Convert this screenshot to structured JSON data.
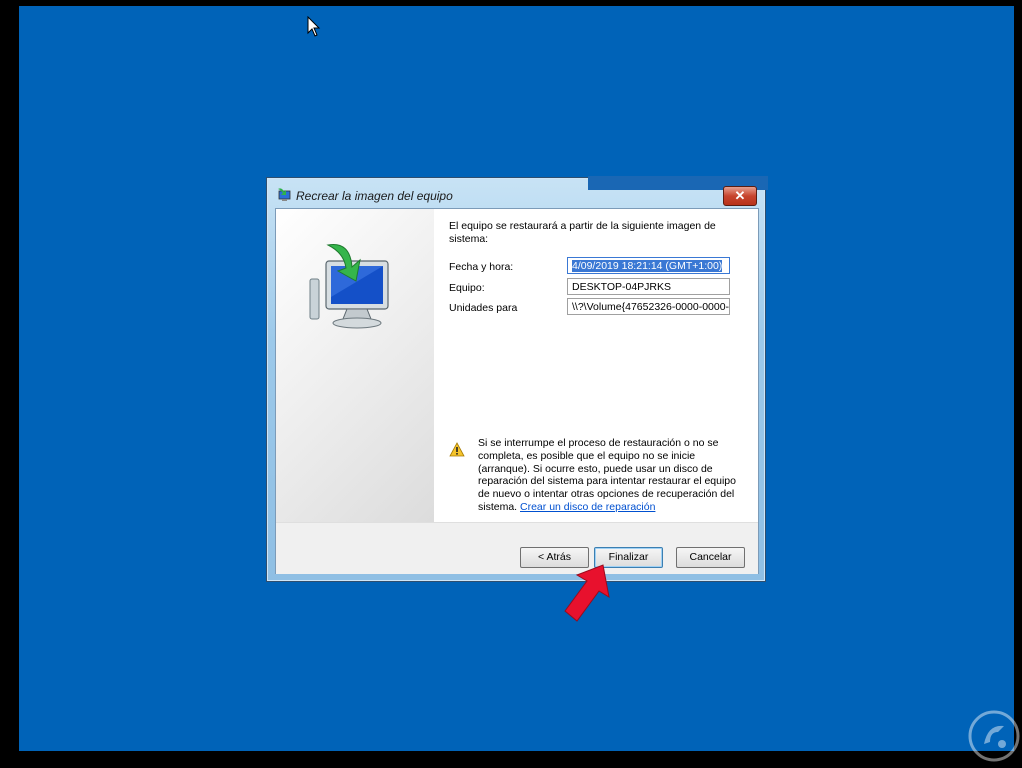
{
  "dialog": {
    "title": "Recrear la imagen del equipo",
    "close_label": "✕",
    "intro": "El equipo se restaurará a partir de la siguiente imagen de sistema:",
    "fields": {
      "date_label": "Fecha y hora:",
      "date_value": "4/09/2019 18:21:14 (GMT+1:00)",
      "computer_label": "Equipo:",
      "computer_value": "DESKTOP-04PJRKS",
      "drives_label": "Unidades para",
      "drives_value": "\\\\?\\Volume{47652326-0000-0000-"
    },
    "warning_text": "Si se interrumpe el proceso de restauración o no se completa, es posible que el equipo no se inicie (arranque). Si ocurre esto, puede usar un disco de reparación del sistema para intentar restaurar el equipo de nuevo o intentar otras opciones de recuperación del sistema.",
    "warning_link": "Crear un disco de reparación",
    "buttons": {
      "back": "< Atrás",
      "finish": "Finalizar",
      "cancel": "Cancelar"
    }
  },
  "icons": {
    "title": "restore-pc-icon",
    "illustration": "computer-restore-icon",
    "warning": "warning-icon",
    "cursor": "mouse-pointer-icon",
    "annotation": "red-arrow-icon",
    "watermark": "logo-icon"
  },
  "colors": {
    "desktop": "#0063b8",
    "selection": "#3a78d4",
    "link": "#0050d0",
    "annotation_arrow": "#e8112d"
  }
}
